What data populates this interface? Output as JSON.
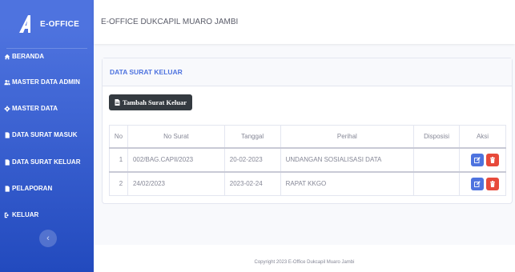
{
  "sidebar": {
    "brand": "E-OFFICE",
    "items": [
      {
        "label": "BERANDA",
        "icon": "home-icon"
      },
      {
        "label": "MASTER DATA ADMIN",
        "icon": "users-icon"
      },
      {
        "label": "MASTER DATA",
        "icon": "gear-icon"
      },
      {
        "label": "DATA SURAT MASUK",
        "icon": "file-icon"
      },
      {
        "label": "DATA SURAT KELUAR",
        "icon": "file-icon"
      },
      {
        "label": "PELAPORAN",
        "icon": "file-icon"
      },
      {
        "label": "KELUAR",
        "icon": "logout-icon"
      }
    ],
    "toggle_icon": "chevron-left-icon"
  },
  "topbar": {
    "title": "E-OFFICE DUKCAPIL MUARO JAMBI"
  },
  "card": {
    "title": "DATA SURAT KELUAR",
    "add_button": "Tambah Surat Keluar",
    "table": {
      "headers": [
        "No",
        "No Surat",
        "Tanggal",
        "Perihal",
        "Disposisi",
        "Aksi"
      ],
      "rows": [
        [
          "1",
          "002/BAG.CAPIl/2023",
          "20-02-2023",
          "UNDANGAN SOSIALISASI DATA",
          ""
        ],
        [
          "2",
          "24/02/2023",
          "2023-02-24",
          "RAPAT KKGO",
          ""
        ]
      ]
    }
  },
  "footer": {
    "copyright": "Copyright 2023 E-Office Dukcapil Muaro Jambi"
  },
  "colors": {
    "primary": "#4e73df",
    "danger": "#e74a3b",
    "dark": "#343a40"
  }
}
